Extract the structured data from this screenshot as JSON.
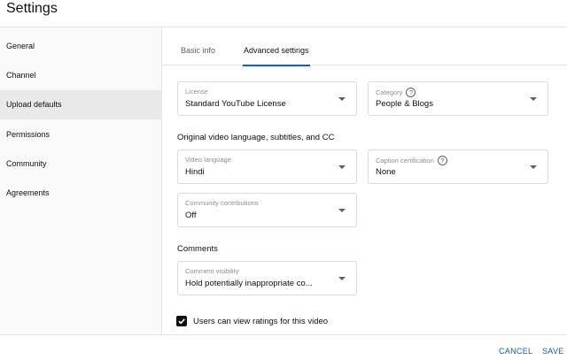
{
  "header": {
    "title": "Settings"
  },
  "sidebar": {
    "items": [
      {
        "label": "General"
      },
      {
        "label": "Channel"
      },
      {
        "label": "Upload defaults"
      },
      {
        "label": "Permissions"
      },
      {
        "label": "Community"
      },
      {
        "label": "Agreements"
      }
    ],
    "active": "Upload defaults"
  },
  "tabs": [
    {
      "label": "Basic info"
    },
    {
      "label": "Advanced settings"
    }
  ],
  "active_tab": "Advanced settings",
  "fields": {
    "license": {
      "label": "License",
      "value": "Standard YouTube License"
    },
    "category": {
      "label": "Category",
      "value": "People & Blogs"
    },
    "video_language": {
      "label": "Video language",
      "value": "Hindi"
    },
    "caption_certification": {
      "label": "Caption certification",
      "value": "None"
    },
    "community_contributions": {
      "label": "Community contributions",
      "value": "Off"
    },
    "comment_visibility": {
      "label": "Comment visibility",
      "value": "Hold potentially inappropriate co..."
    }
  },
  "sections": {
    "language": "Original video language, subtitles, and CC",
    "comments": "Comments"
  },
  "ratings_checkbox": {
    "label": "Users can view ratings for this video",
    "checked": true
  },
  "footer": {
    "cancel": "CANCEL",
    "save": "SAVE"
  },
  "colors": {
    "accent": "#065fd4",
    "sidebar_bg": "#f9f9f9",
    "active_item_bg": "#e9e9e9"
  }
}
